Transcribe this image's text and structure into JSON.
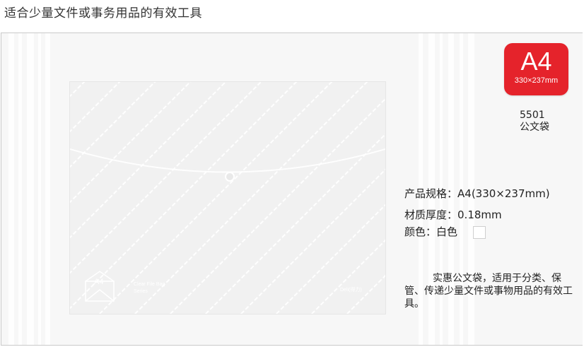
{
  "headline": "适合少量文件或事务用品的有效工具",
  "badge": {
    "size": "A4",
    "dimensions": "330×237mm"
  },
  "model": {
    "number": "5501",
    "name": "公文袋"
  },
  "specs": {
    "size_label": "产品规格：",
    "size_value": "A4(330×237mm)",
    "thickness_label": "材质厚度：",
    "thickness_value": "0.18mm",
    "color_label": "颜色：",
    "color_value": "白色"
  },
  "description": "实惠公文袋，适用于分类、保管、传递少量文件或事物用品的有效工具。",
  "bag_print": {
    "size": "A4",
    "series_line1": "Clear File Bag",
    "series_line2": "Series",
    "brand": "Deli(得力)"
  },
  "colors": {
    "badge_red": "#e5232b",
    "swatch": "#ffffff"
  }
}
